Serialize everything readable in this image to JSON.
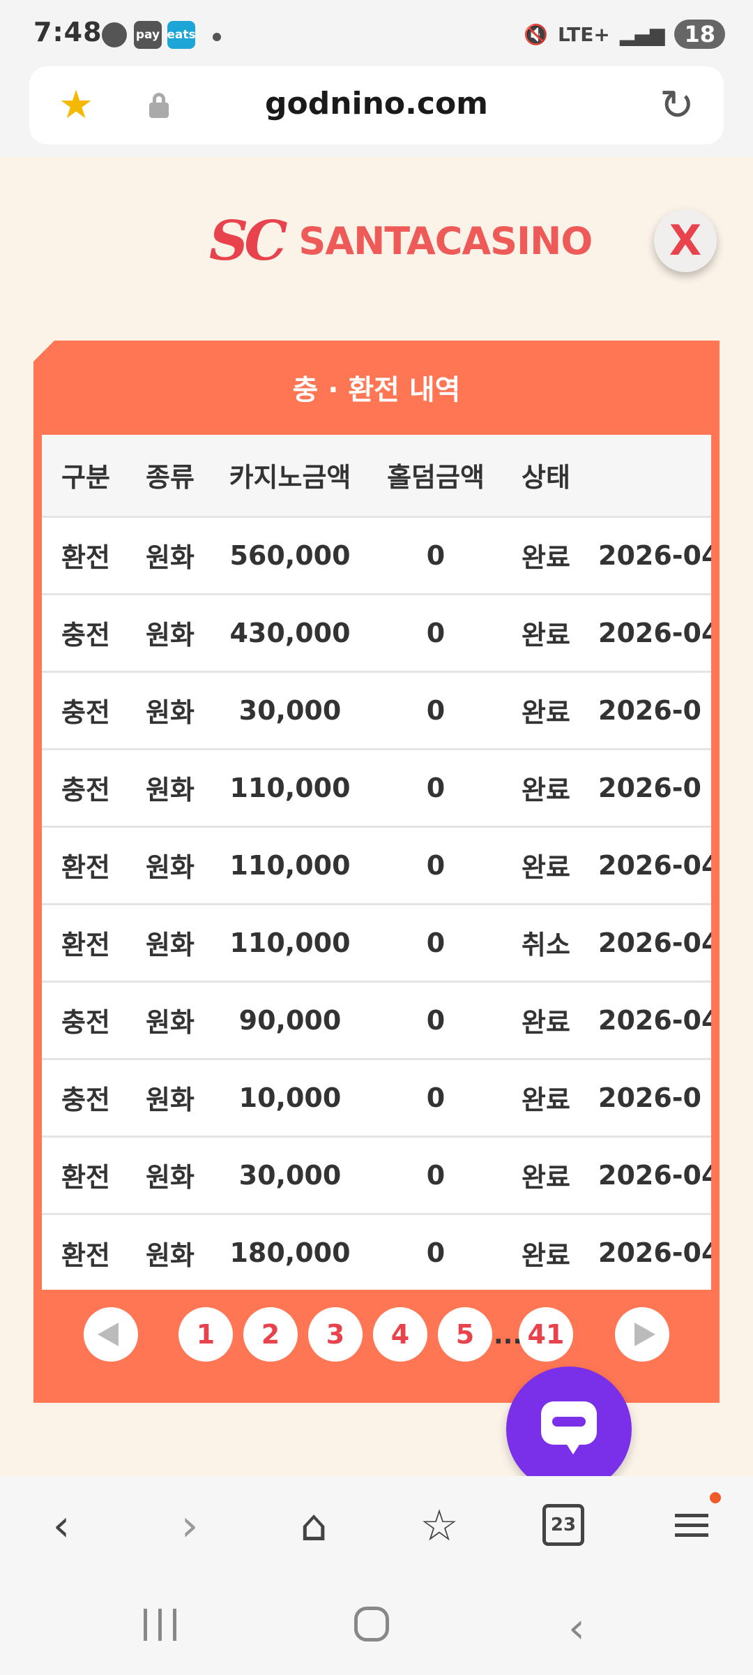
{
  "status_bar": {
    "time": "7:48",
    "pay_label": "pay",
    "eats_label": "eats",
    "network": "LTE+",
    "battery": "18"
  },
  "browser": {
    "url": "godnino.com",
    "tabs_count": "23"
  },
  "logo": {
    "mark": "SC",
    "text": "SANTACASINO"
  },
  "panel": {
    "title": "충 · 환전 내역",
    "headers": [
      "구분",
      "종류",
      "카지노금액",
      "홀덤금액",
      "상태",
      ""
    ],
    "rows": [
      [
        "환전",
        "원화",
        "560,000",
        "0",
        "완료",
        "2026-04"
      ],
      [
        "충전",
        "원화",
        "430,000",
        "0",
        "완료",
        "2026-04"
      ],
      [
        "충전",
        "원화",
        "30,000",
        "0",
        "완료",
        "2026-0"
      ],
      [
        "충전",
        "원화",
        "110,000",
        "0",
        "완료",
        "2026-0"
      ],
      [
        "환전",
        "원화",
        "110,000",
        "0",
        "완료",
        "2026-04"
      ],
      [
        "환전",
        "원화",
        "110,000",
        "0",
        "취소",
        "2026-04"
      ],
      [
        "충전",
        "원화",
        "90,000",
        "0",
        "완료",
        "2026-04"
      ],
      [
        "충전",
        "원화",
        "10,000",
        "0",
        "완료",
        "2026-0"
      ],
      [
        "환전",
        "원화",
        "30,000",
        "0",
        "완료",
        "2026-04"
      ],
      [
        "환전",
        "원화",
        "180,000",
        "0",
        "완료",
        "2026-04"
      ]
    ],
    "pagination": {
      "pages": [
        "1",
        "2",
        "3",
        "4",
        "5"
      ],
      "ellipsis": "...",
      "last_page": "41"
    }
  },
  "colors": {
    "panel": "#ff7654",
    "page_bg": "#fbf3e8",
    "accent_red": "#e8434d",
    "chat_purple": "#7a2fe9"
  },
  "icons": [
    "star-icon",
    "lock-icon",
    "reload-icon",
    "close-icon",
    "chat-icon",
    "back-icon",
    "forward-icon",
    "home-icon",
    "bookmarks-icon",
    "tabs-icon",
    "menu-icon"
  ]
}
